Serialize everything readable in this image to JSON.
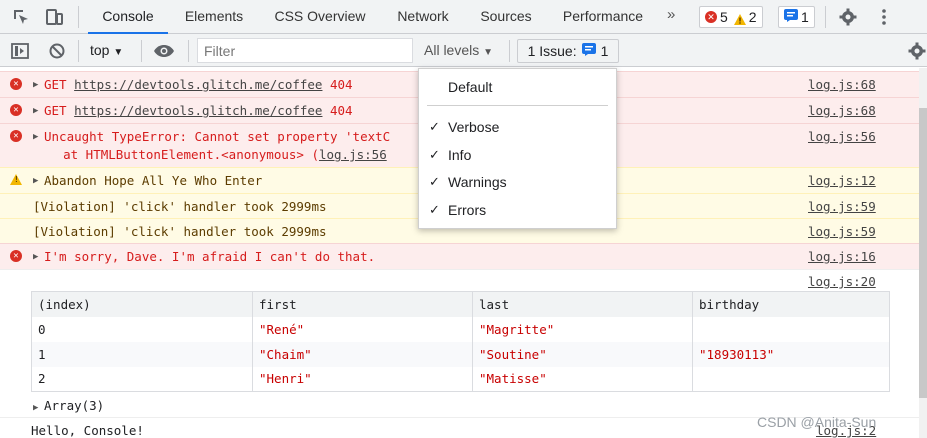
{
  "tabs": [
    "Console",
    "Elements",
    "CSS Overview",
    "Network",
    "Sources",
    "Performance"
  ],
  "more_tabs": "»",
  "counts": {
    "errors": "5",
    "warnings": "2",
    "issues": "1"
  },
  "toolbar": {
    "context": "top",
    "filter_placeholder": "Filter",
    "levels": "All levels",
    "issues_label": "1 Issue:",
    "issues_count": "1"
  },
  "messages": [
    {
      "level": "error",
      "text_prefix": "GET ",
      "url": "https://devtools.glitch.me/coffee",
      "status": " 404",
      "src": "log.js:68"
    },
    {
      "level": "error",
      "text_prefix": "GET ",
      "url": "https://devtools.glitch.me/coffee",
      "status": " 404",
      "src": "log.js:68"
    },
    {
      "level": "error",
      "line1": "Uncaught TypeError: Cannot set property 'textC",
      "line2": "    at HTMLButtonElement.<anonymous> (",
      "line2_link": "log.js:56",
      "src": "log.js:56"
    },
    {
      "level": "warn",
      "text": "Abandon Hope All Ye Who Enter",
      "src": "log.js:12"
    },
    {
      "level": "warn",
      "text": "[Violation] 'click' handler took 2999ms",
      "src": "log.js:59"
    },
    {
      "level": "warn",
      "text": "[Violation] 'click' handler took 2999ms",
      "src": "log.js:59"
    },
    {
      "level": "error",
      "text": "I'm sorry, Dave. I'm afraid I can't do that.",
      "src": "log.js:16"
    },
    {
      "level": "info",
      "text": "",
      "src": "log.js:20"
    }
  ],
  "table": {
    "headers": [
      "(index)",
      "first",
      "last",
      "birthday"
    ],
    "rows": [
      [
        "0",
        "\"René\"",
        "\"Magritte\"",
        ""
      ],
      [
        "1",
        "\"Chaim\"",
        "\"Soutine\"",
        "\"18930113\""
      ],
      [
        "2",
        "\"Henri\"",
        "\"Matisse\"",
        ""
      ]
    ]
  },
  "array_label": "Array(3)",
  "last_message": {
    "text": "Hello, Console!",
    "src": "log.js:2"
  },
  "menu": {
    "default": "Default",
    "items": [
      {
        "label": "Verbose",
        "checked": true
      },
      {
        "label": "Info",
        "checked": true
      },
      {
        "label": "Warnings",
        "checked": true
      },
      {
        "label": "Errors",
        "checked": true
      }
    ],
    "check_glyph": "✓"
  },
  "watermark": "CSDN @Anita-Sun",
  "colors": {
    "accent": "#1a73e8",
    "error": "#d93025",
    "warning": "#f2b600"
  }
}
